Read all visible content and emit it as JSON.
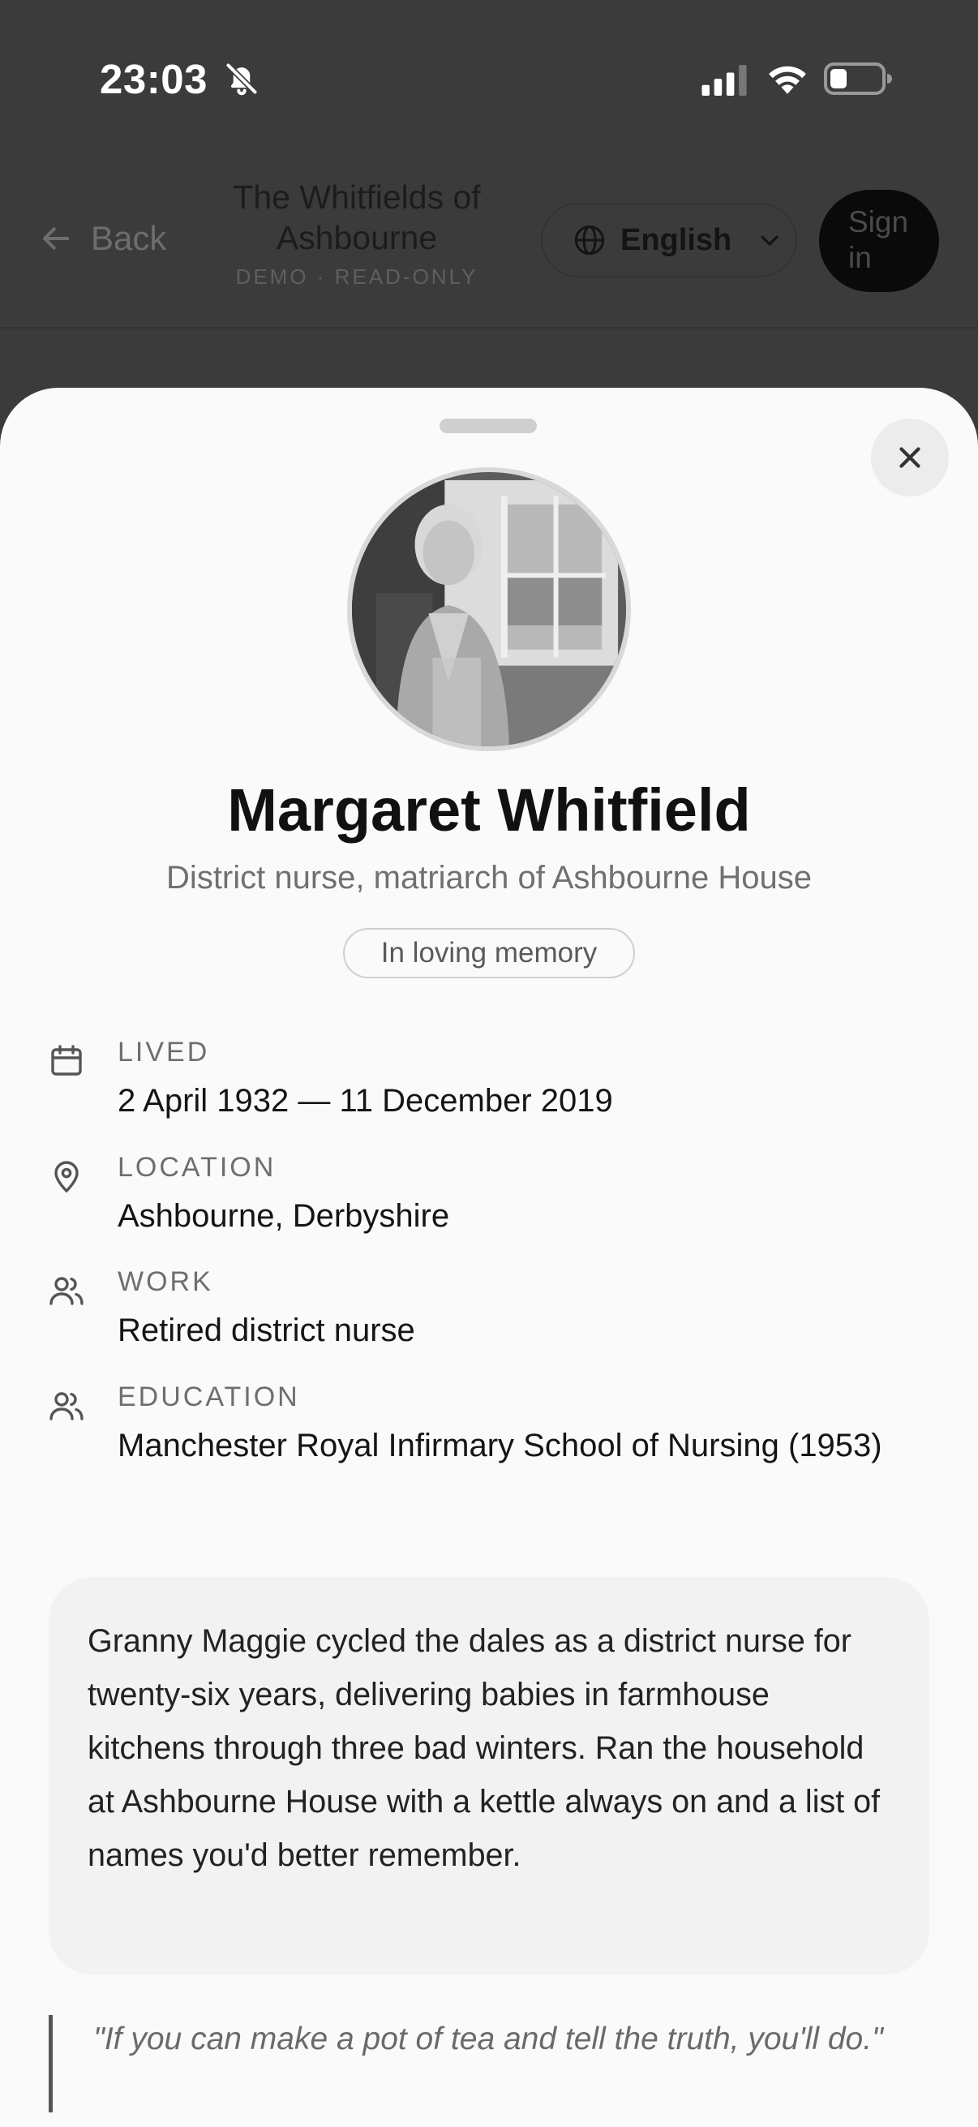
{
  "status_bar": {
    "time": "23:03",
    "icons": [
      "bell-slash-icon",
      "signal-icon",
      "wifi-icon",
      "battery-icon"
    ]
  },
  "header": {
    "back_label": "Back",
    "title": "The Whitfields of Ashbourne",
    "subtitle": "DEMO · READ-ONLY",
    "language_label": "English",
    "sign_in_label": "Sign in"
  },
  "profile": {
    "name": "Margaret Whitfield",
    "tagline": "District nurse, matriarch of Ashbourne House",
    "badge": "In loving memory",
    "facts": [
      {
        "icon": "calendar-icon",
        "label": "LIVED",
        "value": "2 April 1932 — 11 December 2019"
      },
      {
        "icon": "location-pin-icon",
        "label": "LOCATION",
        "value": "Ashbourne, Derbyshire"
      },
      {
        "icon": "people-icon",
        "label": "WORK",
        "value": "Retired district nurse"
      },
      {
        "icon": "people-icon",
        "label": "EDUCATION",
        "value": "Manchester Royal Infirmary School of Nursing (1953)"
      }
    ],
    "bio": "Granny Maggie cycled the dales as a district nurse for twenty-six years, delivering babies in farmhouse kitchens through three bad winters. Ran the household at Ashbourne House with a kettle always on and a list of names you'd better remember.",
    "quote": "\"If you can make a pot of tea and tell the truth, you'll do.\""
  },
  "colors": {
    "overlay_bg": "#3b3b3b",
    "sheet_bg": "#fafafa",
    "card_bg": "#f2f2f2",
    "muted_text": "#707070"
  }
}
